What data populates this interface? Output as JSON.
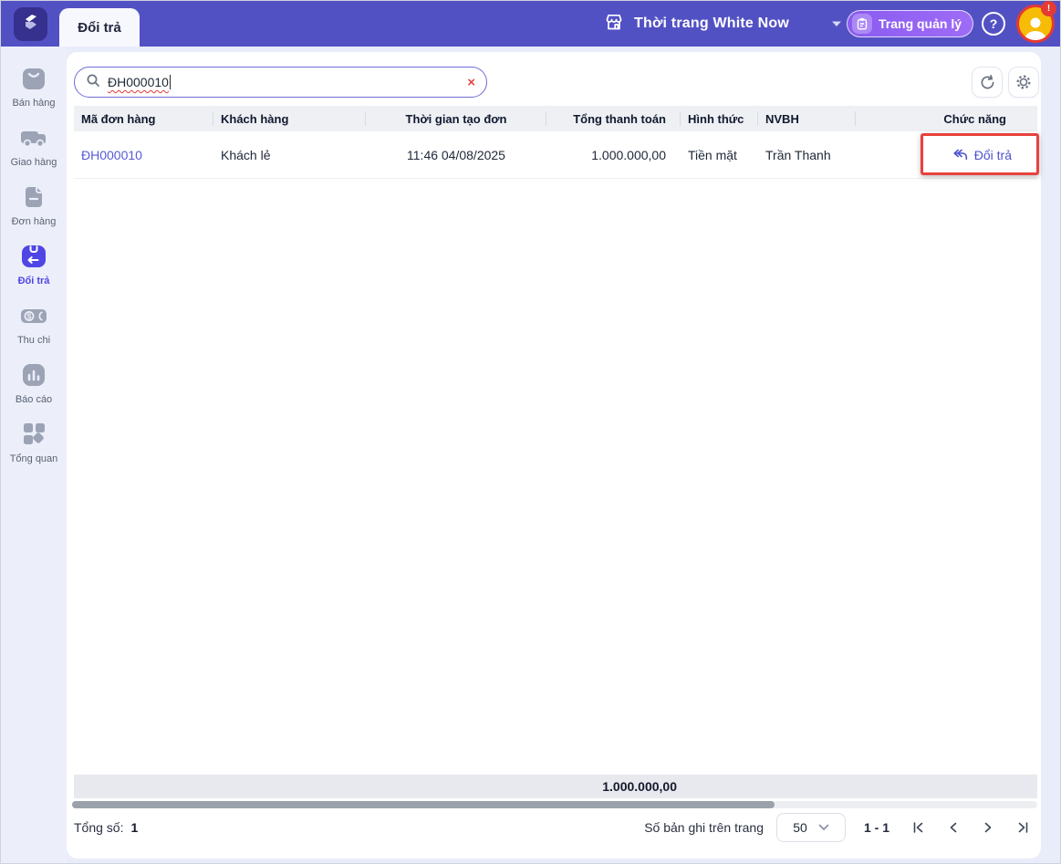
{
  "topbar": {
    "tab_label": "Đổi trả",
    "store_name": "Thời trang White Now",
    "admin_button_label": "Trang quản lý",
    "help_glyph": "?",
    "notification_badge": "!"
  },
  "sidebar": {
    "items": [
      {
        "label": "Bán hàng",
        "icon": "shopping-bag",
        "active": false
      },
      {
        "label": "Giao hàng",
        "icon": "delivery-truck",
        "active": false
      },
      {
        "label": "Đơn hàng",
        "icon": "order-document",
        "active": false
      },
      {
        "label": "Đổi trả",
        "icon": "return-box",
        "active": true
      },
      {
        "label": "Thu chi",
        "icon": "cash",
        "active": false
      },
      {
        "label": "Báo cáo",
        "icon": "bar-chart",
        "active": false
      },
      {
        "label": "Tổng quan",
        "icon": "overview-grid",
        "active": false
      }
    ]
  },
  "search": {
    "value": "ĐH000010",
    "clear_glyph": "×"
  },
  "table": {
    "headers": [
      "Mã đơn hàng",
      "Khách hàng",
      "Thời gian tạo đơn",
      "Tổng thanh toán",
      "Hình thức",
      "NVBH",
      "Chức năng"
    ],
    "rows": [
      {
        "order_code": "ĐH000010",
        "customer": "Khách lẻ",
        "created_at": "11:46 04/08/2025",
        "total": "1.000.000,00",
        "payment_method": "Tiền mặt",
        "salesperson": "Trần Thanh",
        "action_label": "Đổi trả"
      }
    ],
    "summary_total": "1.000.000,00"
  },
  "footer": {
    "total_label": "Tổng số:",
    "total_value": "1",
    "page_size_label": "Số bản ghi trên trang",
    "page_size_value": "50",
    "range": "1 - 1"
  },
  "colors": {
    "topbar": "#5251C4",
    "accent": "#4F46E5",
    "link": "#555BD6",
    "annotation_red": "#E8413C",
    "avatar_yellow": "#F7BC05",
    "badge_red": "#E43A34",
    "sidebar_bg": "#ECEFFA",
    "header_row_bg": "#EEF0F4",
    "summary_bg": "#E7E9EE"
  }
}
